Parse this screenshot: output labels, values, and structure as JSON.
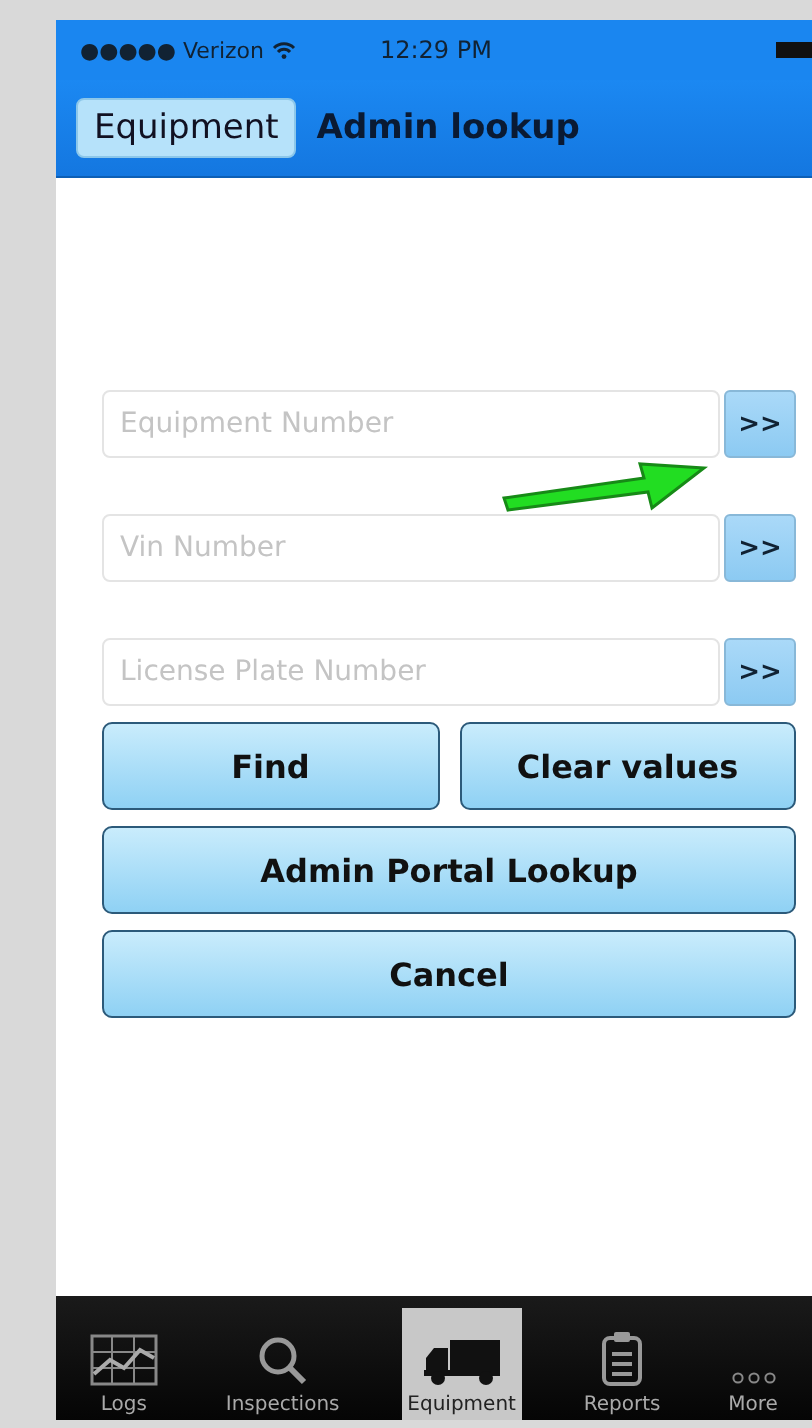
{
  "status_bar": {
    "carrier": "●●●●● Verizon",
    "time": "12:29 PM"
  },
  "nav_bar": {
    "back_button": "Equipment",
    "title": "Admin lookup"
  },
  "fields": [
    {
      "placeholder": "Equipment Number",
      "button": ">>"
    },
    {
      "placeholder": "Vin Number",
      "button": ">>"
    },
    {
      "placeholder": "License Plate Number",
      "button": ">>"
    }
  ],
  "buttons": [
    [
      "Find",
      "Clear values"
    ],
    [
      "Admin Portal Lookup"
    ],
    [
      "Cancel"
    ]
  ],
  "tabs": [
    {
      "label": "Logs",
      "kind": "chart",
      "selected": false
    },
    {
      "label": "Inspections",
      "kind": "search",
      "selected": false
    },
    {
      "label": "Equipment",
      "kind": "truck",
      "selected": true
    },
    {
      "label": "Reports",
      "kind": "clipboard",
      "selected": false
    },
    {
      "label": "More",
      "kind": "more",
      "selected": false
    }
  ]
}
